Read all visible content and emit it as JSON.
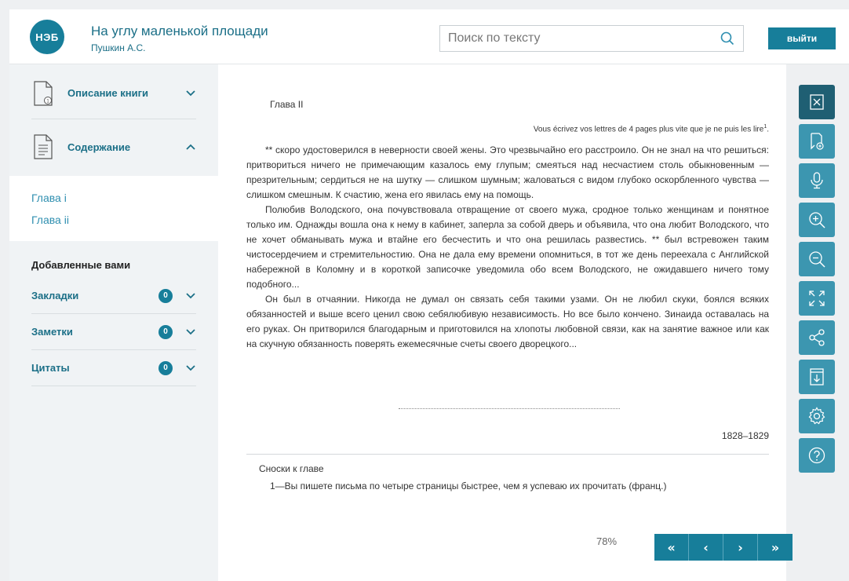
{
  "header": {
    "logo_text": "НЭБ",
    "book_title": "На углу маленькой площади",
    "author": "Пушкин А.С.",
    "search_placeholder": "Поиск по тексту",
    "exit_label": "выйти"
  },
  "sidebar": {
    "description_label": "Описание книги",
    "contents_label": "Содержание",
    "toc": [
      "Глава i",
      "Глава ii"
    ],
    "added_title": "Добавленные вами",
    "added_items": [
      {
        "label": "Закладки",
        "count": "0"
      },
      {
        "label": "Заметки",
        "count": "0"
      },
      {
        "label": "Цитаты",
        "count": "0"
      }
    ]
  },
  "reader": {
    "chapter_title": "Глава II",
    "epigraph": "Vous écrivez vos lettres de 4 pages plus vite que je ne puis les lire",
    "epigraph_ref": "1",
    "paragraphs": [
      "** скоро удостоверился в неверности своей жены. Это чрезвычайно его расстроило. Он не знал на что решиться: притвориться ничего не примечающим казалось ему глупым; смеяться над несчастием столь обыкновенным — презрительным; сердиться не на шутку — слишком шумным; жаловаться с видом глубоко оскорбленного чувства — слишком смешным. К счастию, жена его явилась ему на помощь.",
      "Полюбив Володского, она почувствовала отвращение от своего мужа, сродное только женщинам и понятное только им. Однажды вошла она к нему в кабинет, заперла за собой дверь и объявила, что она любит Володского, что не хочет обманывать мужа и втайне его бесчестить и что она решилась развестись. ** был встревожен таким чистосердечием и стремительностию. Она не дала ему времени опомниться, в тот же день переехала с Английской набережной в Коломну и в короткой записочке уведомила обо всем Володского, не ожидавшего ничего тому подобного...",
      "Он был в отчаянии. Никогда не думал он связать себя такими узами. Он не любил скуки, боялся всяких обязанностей и выше всего ценил свою себялюбивую независимость. Но все было кончено. Зинаида оставалась на его руках. Он притворился благодарным и приготовился на хлопоты любовной связи, как на занятие важное или как на скучную обязанность поверять ежемесячные счеты своего дворецкого..."
    ],
    "years": "1828–1829",
    "footnotes_title": "Сноски к главе",
    "footnote_1": "1—Вы пишете письма по четыре страницы быстрее, чем я успеваю их прочитать (франц.)",
    "progress": "78%"
  },
  "pager": {
    "first": "«",
    "prev": "‹",
    "next": "›",
    "last": "»"
  },
  "toolbar": [
    "close-book-icon",
    "add-bookmark-icon",
    "microphone-icon",
    "zoom-in-icon",
    "zoom-out-icon",
    "fullscreen-icon",
    "share-icon",
    "download-icon",
    "settings-icon",
    "help-icon"
  ],
  "colors": {
    "accent": "#177e9a",
    "link": "#2f8fb0",
    "tool": "#3c96b0",
    "tool_active": "#1f5f73"
  }
}
